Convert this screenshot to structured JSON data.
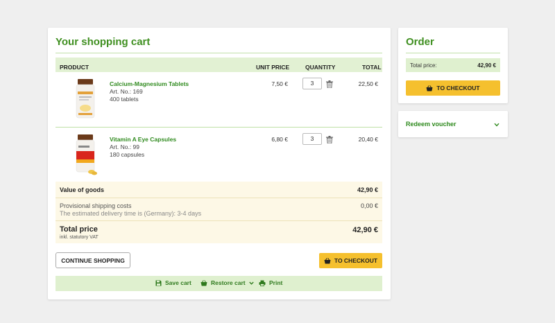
{
  "cart": {
    "title": "Your shopping cart",
    "headers": {
      "product": "PRODUCT",
      "unit_price": "UNIT PRICE",
      "quantity": "QUANTITY",
      "total": "TOTAL"
    },
    "items": [
      {
        "name": "Calcium-Magnesium Tablets",
        "art": "Art. No.: 169",
        "size": "400 tablets",
        "unit_price": "7,50 €",
        "quantity": "3",
        "total": "22,50 €"
      },
      {
        "name": "Vitamin A Eye Capsules",
        "art": "Art. No.: 99",
        "size": "180 capsules",
        "unit_price": "6,80 €",
        "quantity": "3",
        "total": "20,40 €"
      }
    ],
    "summary": {
      "value_label": "Value of goods",
      "value": "42,90 €",
      "shipping_label": "Provisional shipping costs",
      "shipping_note": "The estimated delivery time is (Germany): 3-4 days",
      "shipping": "0,00 €",
      "total_label": "Total price",
      "vat_note": "inkl. statutory VAT",
      "total": "42,90 €"
    },
    "continue_label": "CONTINUE SHOPPING",
    "checkout_label": "TO CHECKOUT",
    "footer": {
      "save": "Save cart",
      "restore": "Restore cart",
      "print": "Print"
    }
  },
  "order": {
    "title": "Order",
    "total_label": "Total price:",
    "total": "42,90 €",
    "checkout_label": "TO CHECKOUT"
  },
  "voucher": {
    "label": "Redeem voucher"
  },
  "colors": {
    "accent_green": "#3f8f20",
    "button_yellow": "#f5c02e",
    "header_bg": "#e2f1d3",
    "summary_bg": "#fdf8e6"
  },
  "icons": [
    "basket-icon",
    "trash-icon",
    "save-icon",
    "restore-icon",
    "print-icon",
    "chevron-down-icon"
  ]
}
